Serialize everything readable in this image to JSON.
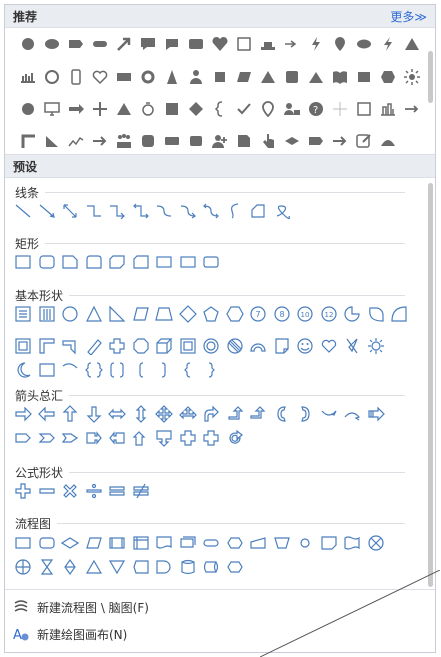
{
  "recommend": {
    "title": "推荐",
    "more": "更多≫"
  },
  "presets": {
    "title": "预设",
    "categories": [
      "线条",
      "矩形",
      "基本形状",
      "箭头总汇",
      "公式形状",
      "流程图"
    ]
  },
  "footer": {
    "new_flowchart": "新建流程图 \\ 脑图(F)",
    "new_canvas": "新建绘图画布(N)"
  },
  "colors": {
    "accent": "#2d6bd8",
    "fill_icon": "#6b6b6b",
    "outline_icon": "#4a7ebd"
  }
}
